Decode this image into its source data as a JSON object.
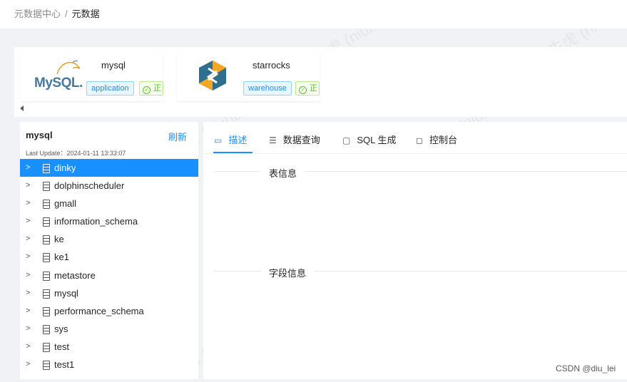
{
  "breadcrumb": {
    "root": "元数据中心",
    "separator": "/",
    "current": "元数据"
  },
  "datasources": [
    {
      "name": "mysql",
      "logo": "mysql-logo",
      "tag": "application",
      "status": "正"
    },
    {
      "name": "starrocks",
      "logo": "starrocks-logo",
      "tag": "warehouse",
      "status": "正"
    }
  ],
  "sidebar": {
    "title": "mysql",
    "refresh": "刷新",
    "last_update": "Last Update：2024-01-11 13:33:07",
    "databases": [
      "dinky",
      "dolphinscheduler",
      "gmall",
      "information_schema",
      "ke",
      "ke1",
      "metastore",
      "mysql",
      "performance_schema",
      "sys",
      "test",
      "test1"
    ],
    "selected": "dinky"
  },
  "tabs": [
    {
      "label": "描述",
      "icon": "book-icon",
      "glyph": "▭"
    },
    {
      "label": "数据查询",
      "icon": "list-icon",
      "glyph": "☰"
    },
    {
      "label": "SQL 生成",
      "icon": "monitor-icon",
      "glyph": "▢"
    },
    {
      "label": "控制台",
      "icon": "laptop-icon",
      "glyph": "◻"
    }
  ],
  "sections": {
    "table_info": "表信息",
    "field_info": "字段信息"
  },
  "watermark": "牛虎 (niuhu83)",
  "footer": "CSDN @diu_lei",
  "colors": {
    "primary": "#1890ff",
    "success": "#52c41a",
    "background": "#f0f2f5"
  }
}
